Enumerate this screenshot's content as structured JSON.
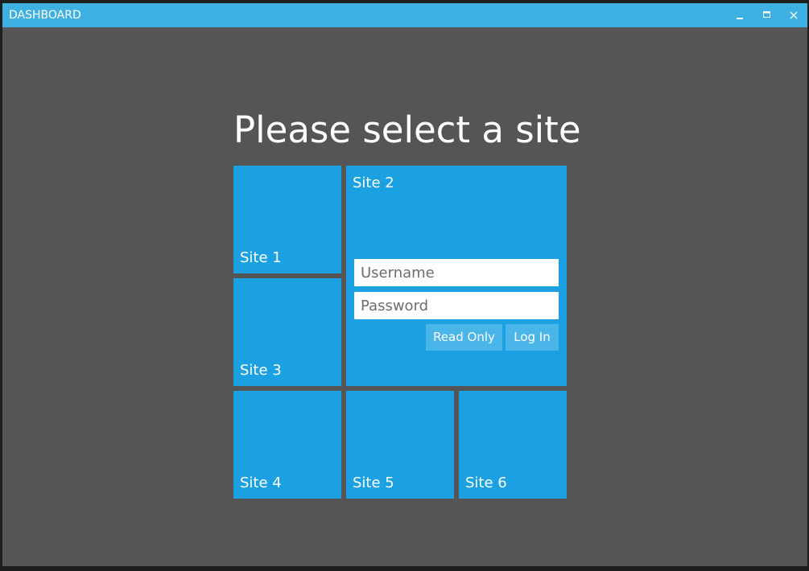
{
  "window": {
    "title": "DASHBOARD",
    "controls": [
      "minimize-icon",
      "maximize-icon",
      "close-icon"
    ]
  },
  "main": {
    "heading": "Please select a site"
  },
  "tiles": [
    {
      "label": "Site 1"
    },
    {
      "label": "Site 2"
    },
    {
      "label": "Site 3"
    },
    {
      "label": "Site 4"
    },
    {
      "label": "Site 5"
    },
    {
      "label": "Site 6"
    }
  ],
  "login": {
    "username_placeholder": "Username",
    "username_value": "",
    "password_placeholder": "Password",
    "password_value": "",
    "readonly_label": "Read Only",
    "login_label": "Log In"
  },
  "colors": {
    "titlebar": "#3eb0e2",
    "background": "#555555",
    "tile": "#1ba1e2",
    "button": "#49b5e8",
    "text": "#ffffff"
  }
}
